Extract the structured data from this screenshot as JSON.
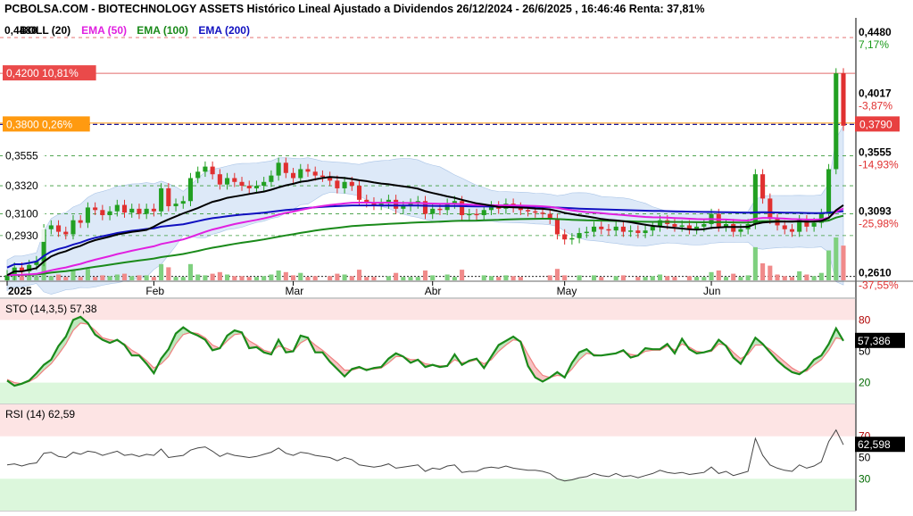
{
  "header": {
    "title": "PCBOLSA.COM - BIOTECHNOLOGY ASSETS Histórico Lineal Ajustado a Dividendos 26/12/2024 - 26/6/2025 , 16:46:46 Renta: 37,81%"
  },
  "legend": [
    {
      "label": "BOLL (20)",
      "color": "#000000"
    },
    {
      "label": "EMA (50)",
      "color": "#e020e0"
    },
    {
      "label": "EMA (100)",
      "color": "#1a8a1a"
    },
    {
      "label": "EMA (200)",
      "color": "#1010c0"
    }
  ],
  "legend_overlap_label": "0,4480",
  "colors": {
    "up": "#22a022",
    "down": "#e03030",
    "boll_fill": "#dde9f8",
    "ema50": "#e020e0",
    "ema100": "#1a8a1a",
    "ema200": "#1010c0",
    "boll_mid": "#000000"
  },
  "level_tags": [
    {
      "text": "0,4200  10,81%",
      "price": 0.42,
      "bg": "#ea4a4a"
    },
    {
      "text": "0,3800  0,26%",
      "price": 0.38,
      "bg": "#ff9a10"
    }
  ],
  "left_levels": [
    {
      "text": "0,3555",
      "price": 0.3555
    },
    {
      "text": "0,3320",
      "price": 0.332
    },
    {
      "text": "0,3100",
      "price": 0.31
    },
    {
      "text": "0,2930",
      "price": 0.293
    }
  ],
  "right_axis": [
    {
      "price": 0.448,
      "value": "0,4480",
      "pct": "7,17%",
      "pct_color": "#1a9a1a"
    },
    {
      "price": 0.4017,
      "value": "0,4017",
      "pct": "-3,87%",
      "pct_color": "#e03030"
    },
    {
      "price": 0.3555,
      "value": "0,3555",
      "pct": "-14,93%",
      "pct_color": "#e03030"
    },
    {
      "price": 0.3093,
      "value": "0,3093",
      "pct": "-25,98%",
      "pct_color": "#e03030"
    },
    {
      "price": 0.261,
      "value": "0,2610",
      "pct": "-37,55%",
      "pct_color": "#e03030"
    }
  ],
  "current_price_label": "0,3790",
  "months": [
    "2025",
    "Feb",
    "Mar",
    "Abr",
    "May",
    "Jun"
  ],
  "sto": {
    "label": "STO (14,3,5)",
    "value": "57,38",
    "current": "57,386",
    "levels": [
      "80",
      "50",
      "20"
    ]
  },
  "rsi": {
    "label": "RSI (14)",
    "value": "62,59",
    "current": "62,598",
    "levels": [
      "70",
      "50",
      "30"
    ]
  },
  "chart_data": [
    {
      "type": "line",
      "title": "BIOTECHNOLOGY ASSETS",
      "x_range": [
        "2024-12-26",
        "2025-06-26"
      ],
      "ylim": [
        0.258,
        0.462
      ],
      "close": [
        0.262,
        0.268,
        0.265,
        0.27,
        0.273,
        0.298,
        0.301,
        0.296,
        0.294,
        0.305,
        0.303,
        0.315,
        0.313,
        0.309,
        0.312,
        0.317,
        0.311,
        0.314,
        0.31,
        0.314,
        0.312,
        0.33,
        0.316,
        0.318,
        0.32,
        0.338,
        0.343,
        0.347,
        0.341,
        0.333,
        0.338,
        0.335,
        0.332,
        0.33,
        0.332,
        0.335,
        0.34,
        0.35,
        0.342,
        0.338,
        0.345,
        0.343,
        0.34,
        0.339,
        0.336,
        0.33,
        0.335,
        0.332,
        0.321,
        0.319,
        0.317,
        0.318,
        0.321,
        0.314,
        0.316,
        0.318,
        0.32,
        0.31,
        0.314,
        0.313,
        0.318,
        0.32,
        0.309,
        0.31,
        0.309,
        0.313,
        0.316,
        0.314,
        0.318,
        0.315,
        0.313,
        0.312,
        0.311,
        0.31,
        0.306,
        0.294,
        0.29,
        0.291,
        0.295,
        0.296,
        0.3,
        0.298,
        0.297,
        0.3,
        0.296,
        0.297,
        0.295,
        0.297,
        0.3,
        0.305,
        0.302,
        0.3,
        0.301,
        0.298,
        0.3,
        0.302,
        0.31,
        0.3,
        0.302,
        0.296,
        0.298,
        0.302,
        0.341,
        0.322,
        0.306,
        0.301,
        0.298,
        0.296,
        0.305,
        0.3,
        0.303,
        0.31,
        0.345,
        0.42,
        0.379
      ],
      "sto_k": [
        22,
        17,
        19,
        22,
        29,
        37,
        42,
        55,
        64,
        80,
        83,
        77,
        66,
        61,
        58,
        61,
        56,
        46,
        46,
        38,
        29,
        43,
        52,
        67,
        73,
        68,
        65,
        61,
        51,
        53,
        65,
        70,
        68,
        53,
        54,
        49,
        47,
        61,
        49,
        50,
        65,
        63,
        49,
        49,
        40,
        33,
        26,
        33,
        35,
        32,
        34,
        35,
        43,
        48,
        45,
        39,
        42,
        35,
        37,
        35,
        36,
        47,
        37,
        41,
        43,
        34,
        45,
        56,
        60,
        64,
        59,
        36,
        25,
        21,
        25,
        30,
        25,
        39,
        49,
        52,
        46,
        46,
        47,
        48,
        51,
        44,
        46,
        53,
        52,
        52,
        57,
        48,
        62,
        52,
        48,
        49,
        51,
        61,
        55,
        44,
        38,
        50,
        63,
        57,
        49,
        41,
        35,
        30,
        28,
        33,
        42,
        46,
        57,
        72,
        60
      ],
      "sto_d": [
        23,
        20,
        19,
        21,
        25,
        32,
        38,
        47,
        57,
        70,
        77,
        76,
        70,
        63,
        61,
        60,
        57,
        51,
        47,
        41,
        34,
        38,
        45,
        57,
        66,
        68,
        67,
        63,
        56,
        53,
        60,
        66,
        67,
        60,
        56,
        51,
        49,
        55,
        53,
        50,
        58,
        62,
        56,
        51,
        45,
        39,
        32,
        32,
        34,
        33,
        33,
        34,
        39,
        45,
        45,
        42,
        42,
        38,
        37,
        36,
        36,
        42,
        39,
        40,
        42,
        38,
        42,
        50,
        56,
        61,
        60,
        47,
        35,
        27,
        25,
        27,
        26,
        33,
        42,
        48,
        47,
        46,
        47,
        48,
        50,
        47,
        46,
        50,
        51,
        51,
        55,
        51,
        57,
        54,
        50,
        49,
        50,
        57,
        56,
        49,
        43,
        47,
        56,
        56,
        52,
        46,
        40,
        34,
        30,
        31,
        37,
        42,
        51,
        63,
        61
      ],
      "rsi": [
        43,
        44,
        42,
        44,
        45,
        54,
        55,
        51,
        50,
        55,
        53,
        56,
        55,
        52,
        54,
        56,
        52,
        53,
        51,
        53,
        52,
        58,
        50,
        51,
        52,
        57,
        59,
        60,
        56,
        51,
        54,
        52,
        51,
        50,
        51,
        53,
        55,
        59,
        54,
        52,
        55,
        54,
        52,
        51,
        50,
        47,
        50,
        48,
        43,
        42,
        41,
        42,
        44,
        40,
        41,
        42,
        43,
        37,
        40,
        39,
        42,
        43,
        36,
        37,
        37,
        40,
        41,
        40,
        42,
        40,
        39,
        38,
        38,
        37,
        35,
        30,
        28,
        29,
        31,
        32,
        35,
        33,
        32,
        35,
        32,
        33,
        31,
        33,
        35,
        38,
        36,
        35,
        36,
        34,
        35,
        36,
        41,
        35,
        37,
        33,
        35,
        37,
        68,
        52,
        43,
        40,
        38,
        37,
        43,
        40,
        42,
        46,
        65,
        76,
        62
      ]
    }
  ]
}
